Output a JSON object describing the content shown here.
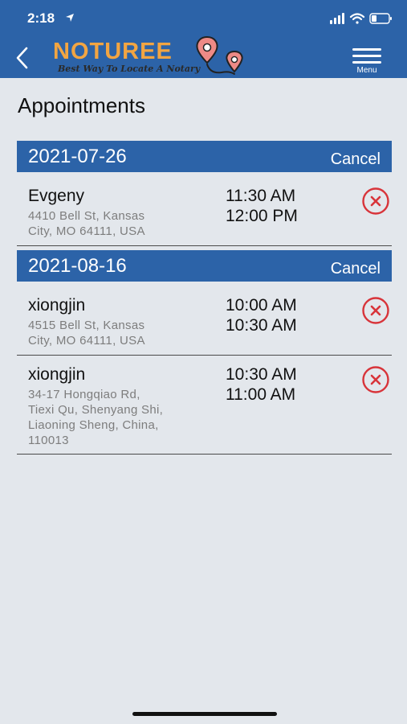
{
  "status": {
    "time": "2:18"
  },
  "header": {
    "logo_title": "NOTUREE",
    "logo_tagline": "Best Way To Locate A Notary",
    "menu_label": "Menu"
  },
  "page": {
    "title": "Appointments"
  },
  "groups": [
    {
      "date": "2021-07-26",
      "cancel_label": "Cancel",
      "appointments": [
        {
          "name": "Evgeny",
          "address_lines": [
            "4410 Bell St, Kansas",
            "City, MO 64111, USA"
          ],
          "start_time": "11:30 AM",
          "end_time": "12:00 PM"
        }
      ]
    },
    {
      "date": "2021-08-16",
      "cancel_label": "Cancel",
      "appointments": [
        {
          "name": "xiongjin",
          "address_lines": [
            "4515 Bell St, Kansas",
            "City, MO 64111, USA"
          ],
          "start_time": "10:00 AM",
          "end_time": "10:30 AM"
        },
        {
          "name": "xiongjin",
          "address_lines": [
            "34-17 Hongqiao Rd,",
            "Tiexi Qu, Shenyang Shi,",
            "Liaoning Sheng, China,",
            "110013"
          ],
          "start_time": "10:30 AM",
          "end_time": "11:00 AM"
        }
      ]
    }
  ],
  "colors": {
    "header_bg": "#2c63a8",
    "logo_accent": "#f2a542",
    "cancel_icon": "#d8343a",
    "page_bg": "#e3e7ec"
  },
  "icons": {
    "back": "chevron-left-icon",
    "menu": "hamburger-menu-icon",
    "remove": "close-circle-icon",
    "location": "location-arrow-icon",
    "signal": "signal-icon",
    "wifi": "wifi-icon",
    "battery": "battery-icon"
  }
}
